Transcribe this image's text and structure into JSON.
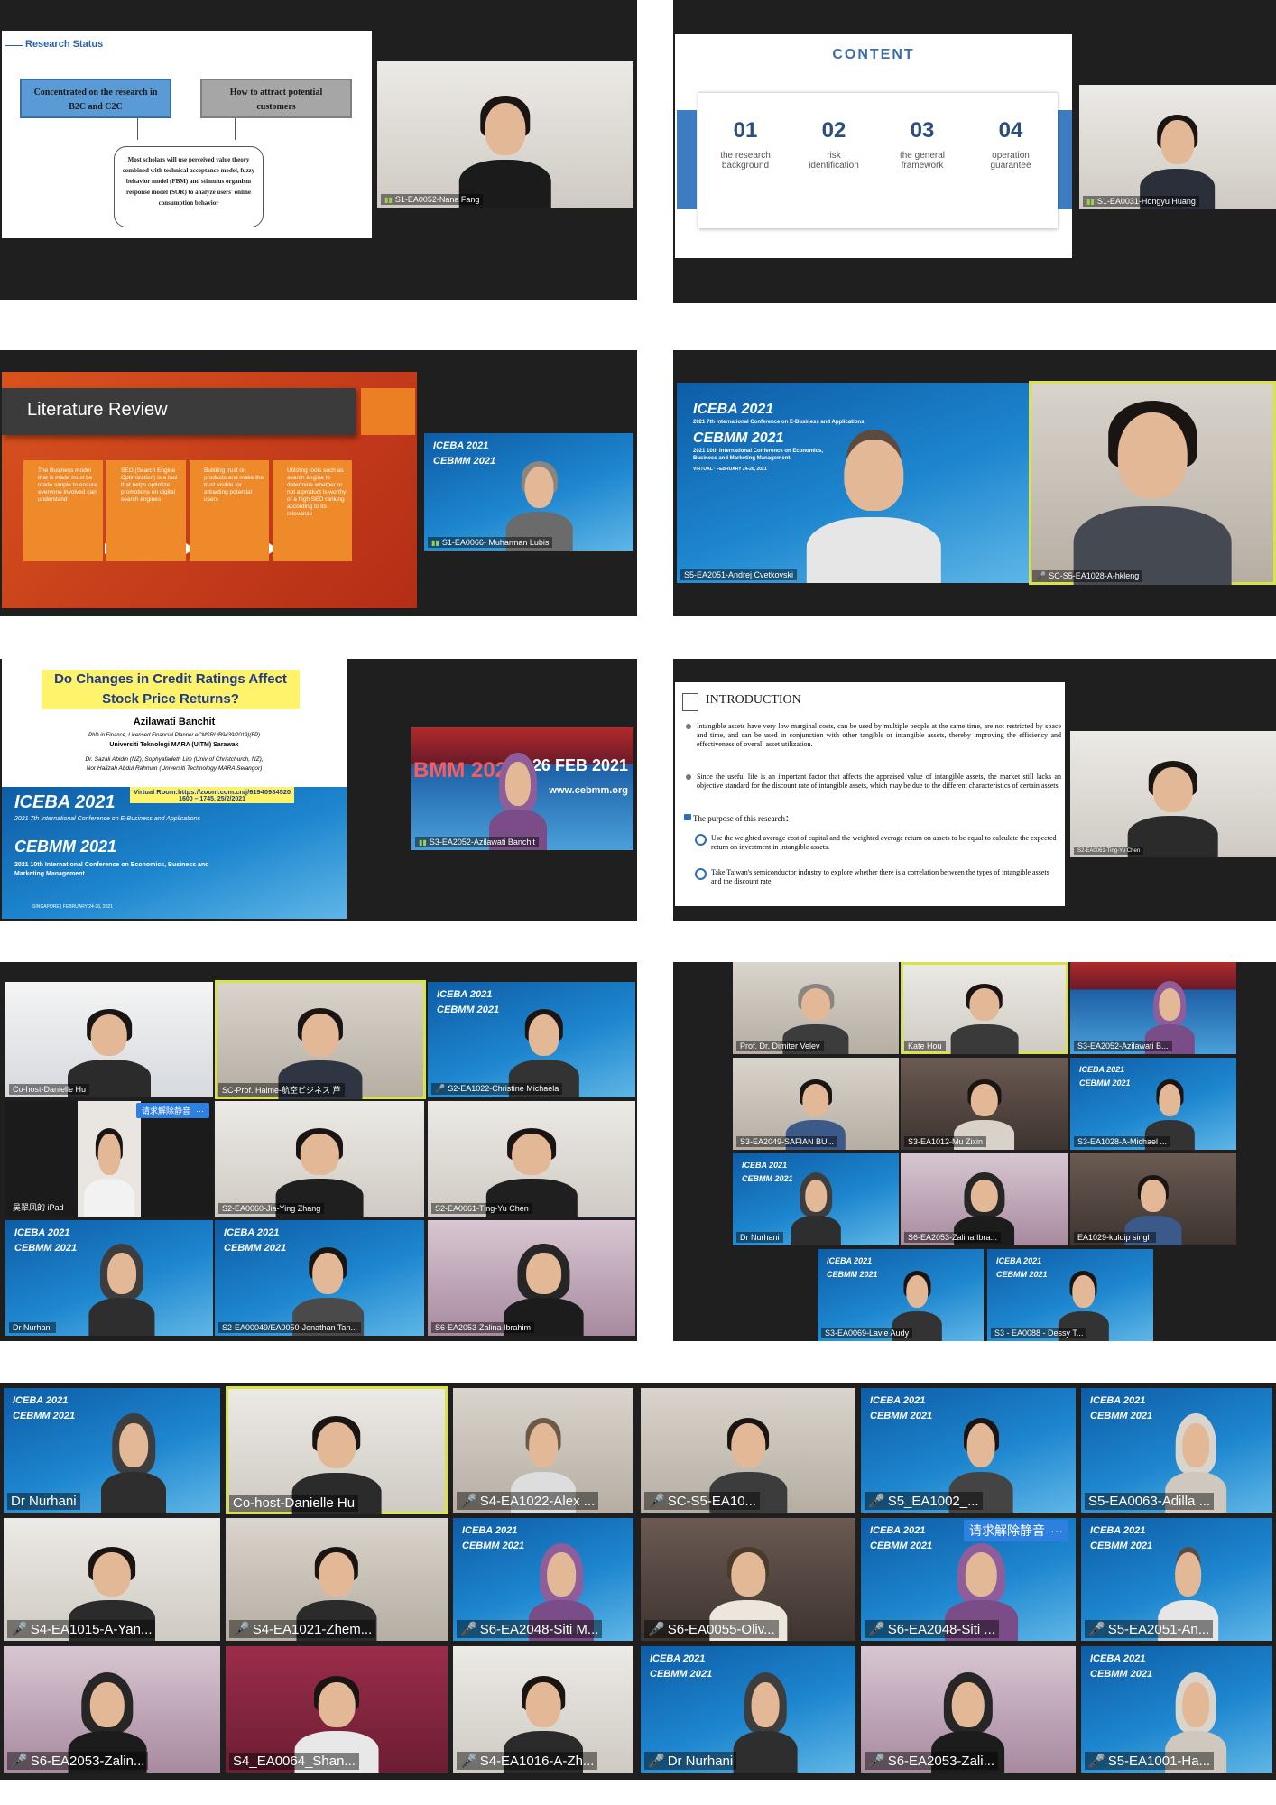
{
  "p1": {
    "title": "Research Status",
    "box1": "Concentrated on the research in B2C and C2C",
    "box2": "How to attract potential customers",
    "body": "Most scholars will use perceived value theory combined with technical acceptance model, fuzzy behavior model (FBM) and stimulus organism response model (SOR) to analyze users' online consumption behavior",
    "speaker": "S1-EA0052-Nana Fang"
  },
  "p2": {
    "title": "CONTENT",
    "items": [
      {
        "num": "01",
        "label": "the research background"
      },
      {
        "num": "02",
        "label": "risk identification"
      },
      {
        "num": "03",
        "label": "the general framework"
      },
      {
        "num": "04",
        "label": "operation guarantee"
      }
    ],
    "speaker": "S1-EA0031-Hongyu Huang"
  },
  "p3": {
    "title": "Literature Review",
    "boxes": [
      "The Business model that is made must be made simple to ensure everyone involved can understand",
      "SEO (Search Engine Optimization) is a tool that helps optimize promotions on digital search engines",
      "Building trust on products and make the trust visible for attracting potential users",
      "Utilizing tools such as search engine to determine whether or not a product is worthy of a high SEO ranking according to its relevance"
    ],
    "speaker": "S1-EA0066- Muharman Lubis",
    "brand1": "ICEBA 2021",
    "brand2": "CEBMM 2021"
  },
  "p4": {
    "brand1": "ICEBA 2021",
    "brand1_sub": "2021 7th International Conference on E-Business and Applications",
    "brand2": "CEBMM 2021",
    "brand2_sub": "2021 10th International Conference on Economics, Business and Marketing Management",
    "virtual": "VIRTUAL · FEBRUARY 24-26, 2021",
    "name1": "S5-EA2051-Andrej Cvetkovski",
    "name2": "SC-S5-EA1028-A-hkleng"
  },
  "p5": {
    "title": "Do Changes in Credit Ratings Affect Stock Price Returns?",
    "author": "Azilawati Banchit",
    "author_line1": "PhD in Finance, Licensed Financial Planner eCMSRL/B9439/2019)(FP)",
    "author_line2": "Universiti Teknologi MARA (UiTM) Sarawak",
    "coauthor1": "Dr. Sazali Abidin (NZ), Sophyafadeth Lim (Univ of Christchurch, NZ),",
    "coauthor2": "Nor Hafizah Abdul Rahman (Universiti Technology MARA Selangor)",
    "room": "Virtual Room:https://zoom.com.cn/j/61940984520",
    "time": "1600 – 1745, 25/2/2021",
    "brand1": "ICEBA 2021",
    "brand1_sub": "2021 7th International Conference on E-Business and Applications",
    "brand2": "CEBMM 2021",
    "brand2_sub": "2021 10th International Conference on Economics, Business and Marketing Management",
    "footer": "SINGAPORE | FEBRUARY 24-26, 2021",
    "bg_title": "BMM 2021",
    "bg_date": "24-26 FEB 2021",
    "bg_url": "www.cebmm.org",
    "speaker": "S3-EA2052-Azilawati Banchit"
  },
  "p6": {
    "title": "INTRODUCTION",
    "bullet1": "Intangible assets have very low marginal costs, can be used by multiple people at the same time, are not restricted by space and time, and can be used in conjunction with other tangible or intangible assets, thereby improving the efficiency and effectiveness of overall asset utilization.",
    "bullet2": "Since the useful life is an important factor that affects the appraised value of intangible assets, the market still lacks an objective standard for the discount rate of intangible assets, which may be due to the different characteristics of certain assets.",
    "purpose": "The purpose of this research：",
    "item1": "Use the weighted average cost of capital and the weighted average return on assets to be equal to calculate the expected return on investment in intangible assets.",
    "item2": "Take Taiwan's semiconductor industry to explore whether there is a correlation between the types of intangible assets and the discount rate.",
    "speaker": "S2-EA0061-Ting-Yu Chen"
  },
  "p7": {
    "tiles": [
      "Co-host-Danielle Hu",
      "SC-Prof. Haime-航空ビジネス 芦",
      "S2-EA1022-Christine Michaela",
      "吴翠凤的 iPad",
      "S2-EA0060-Jia-Ying Zhang",
      "S2-EA0061-Ting-Yu Chen",
      "Dr Nurhani",
      "S2-EA00049/EA0050-Jonathan Tan...",
      "S6-EA2053-Zalina Ibrahim"
    ],
    "banner": "请求解除静音"
  },
  "p8": {
    "tiles": [
      "Prof. Dr. Dimiter Velev",
      "Kate Hou",
      "S3-EA2052-Azilawati B...",
      "S3-EA2049-SAFIAN BU...",
      "S3-EA1012-Mu Zixin",
      "S3-EA1028-A-Michael ...",
      "Dr Nurhani",
      "S6-EA2053-Zalina Ibra...",
      "EA1029-kuldip singh",
      "S3-EA0069-Lavie Audy",
      "S3 - EA0088 - Dessy T..."
    ]
  },
  "p9": {
    "tiles": [
      "Dr Nurhani",
      "Co-host-Danielle Hu",
      "S4-EA1022-Alex ...",
      "SC-S5-EA10...",
      "S5_EA1002_...",
      "S5-EA0063-Adilla ...",
      "S4-EA1015-A-Yan...",
      "S4-EA1021-Zhem...",
      "S6-EA2048-Siti M...",
      "S6-EA0055-Oliv...",
      "S6-EA2048-Siti ...",
      "S5-EA2051-An...",
      "S6-EA2053-Zalin...",
      "S4_EA0064_Shan...",
      "S4-EA1016-A-Zh...",
      "Dr Nurhani",
      "S6-EA2053-Zali...",
      "S5-EA1001-Ha..."
    ],
    "banner": "请求解除静音"
  },
  "brand_small1": "ICEBA 2021",
  "brand_small2": "CEBMM 2021"
}
